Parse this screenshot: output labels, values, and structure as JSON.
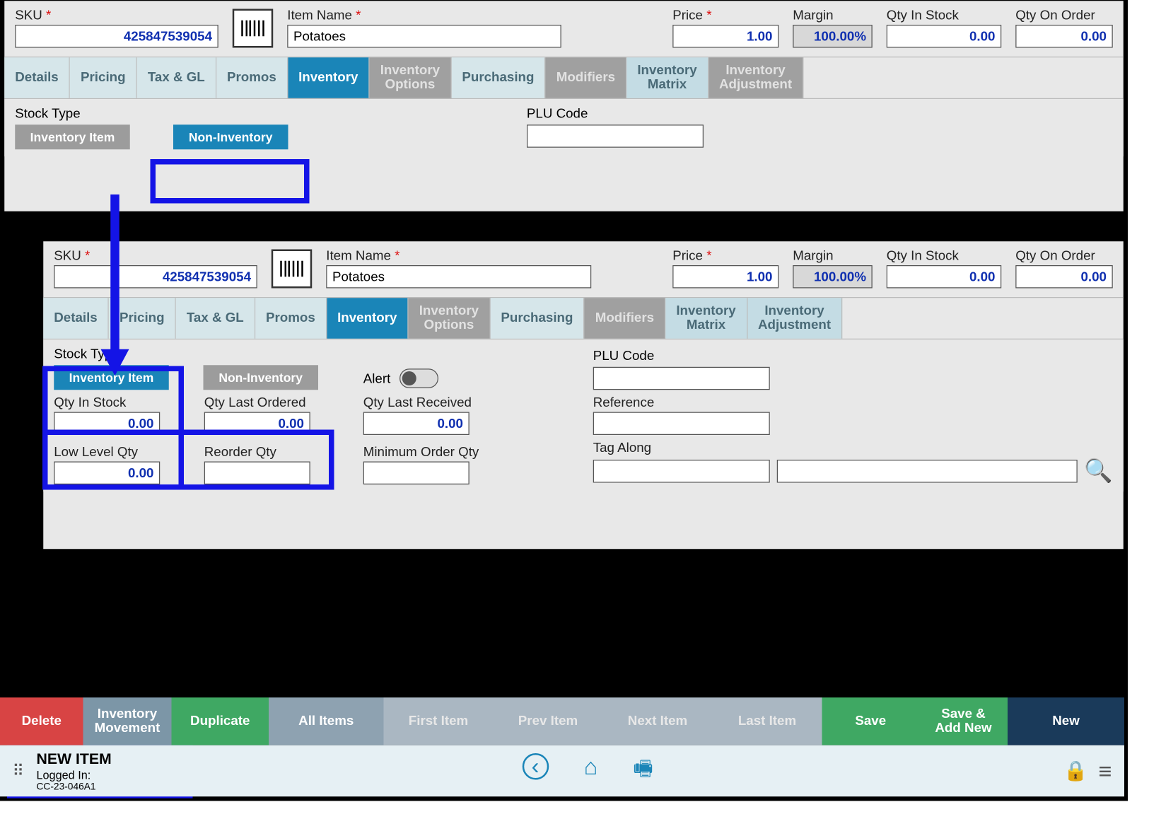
{
  "top": {
    "sku_label": "SKU",
    "sku_value": "425847539054",
    "item_name_label": "Item Name",
    "item_name_value": "Potatoes",
    "price_label": "Price",
    "price_value": "1.00",
    "margin_label": "Margin",
    "margin_value": "100.00%",
    "qty_stock_label": "Qty In Stock",
    "qty_stock_value": "0.00",
    "qty_order_label": "Qty On Order",
    "qty_order_value": "0.00",
    "tabs": [
      "Details",
      "Pricing",
      "Tax & GL",
      "Promos",
      "Inventory",
      "Inventory\nOptions",
      "Purchasing",
      "Modifiers",
      "Inventory\nMatrix",
      "Inventory\nAdjustment"
    ],
    "stock_type_label": "Stock Type",
    "stock_inventory": "Inventory Item",
    "stock_noninventory": "Non-Inventory",
    "plu_label": "PLU Code"
  },
  "bot": {
    "sku_label": "SKU",
    "sku_value": "425847539054",
    "item_name_label": "Item Name",
    "item_name_value": "Potatoes",
    "price_label": "Price",
    "price_value": "1.00",
    "margin_label": "Margin",
    "margin_value": "100.00%",
    "qty_stock_label": "Qty In Stock",
    "qty_stock_value": "0.00",
    "qty_order_label": "Qty On Order",
    "qty_order_value": "0.00",
    "tabs": [
      "Details",
      "Pricing",
      "Tax & GL",
      "Promos",
      "Inventory",
      "Inventory\nOptions",
      "Purchasing",
      "Modifiers",
      "Inventory\nMatrix",
      "Inventory\nAdjustment"
    ],
    "stock_type_label": "Stock Type",
    "stock_inventory": "Inventory Item",
    "stock_noninventory": "Non-Inventory",
    "alert_label": "Alert",
    "plu_label": "PLU Code",
    "qty_in_stock_label": "Qty In Stock",
    "qty_in_stock": "0.00",
    "qty_last_ordered_label": "Qty Last Ordered",
    "qty_last_ordered": "0.00",
    "qty_last_received_label": "Qty Last Received",
    "qty_last_received": "0.00",
    "reference_label": "Reference",
    "low_level_label": "Low Level Qty",
    "low_level": "0.00",
    "reorder_label": "Reorder Qty",
    "min_order_label": "Minimum Order Qty",
    "tag_along_label": "Tag Along"
  },
  "actions": {
    "delete": "Delete",
    "inv_move": "Inventory\nMovement",
    "duplicate": "Duplicate",
    "all_items": "All Items",
    "first": "First Item",
    "prev": "Prev Item",
    "next": "Next Item",
    "last": "Last Item",
    "save": "Save",
    "save_add": "Save &\nAdd New",
    "new": "New"
  },
  "status": {
    "title": "NEW ITEM",
    "logged": "Logged In:",
    "code": "CC-23-046A1"
  }
}
